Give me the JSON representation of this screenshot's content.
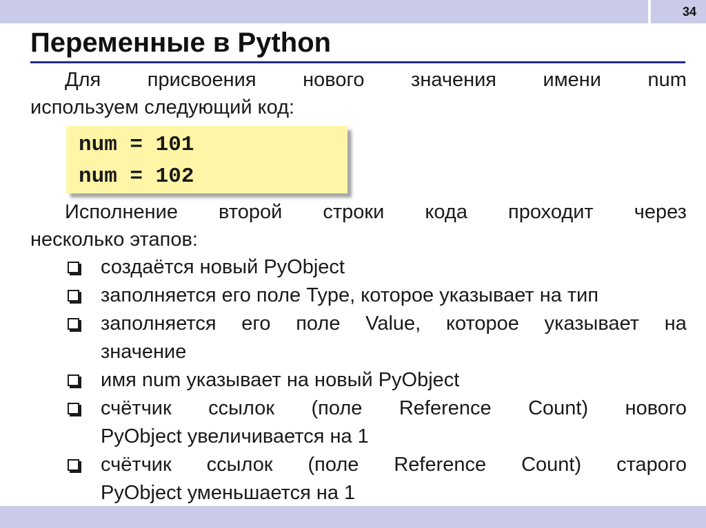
{
  "slide": {
    "page_number": "34",
    "title": "Переменные в Python"
  },
  "intro": {
    "line1_words": [
      "Для",
      "присвоения",
      "нового",
      "значения",
      "имени",
      "num"
    ],
    "line2": "используем следующий код:"
  },
  "code": {
    "lines": [
      "num = 101",
      "num = 102"
    ]
  },
  "execution": {
    "line1_words": [
      "Исполнение",
      "второй",
      "строки",
      "кода",
      "проходит",
      "через"
    ],
    "line2": "несколько этапов:"
  },
  "bullets": [
    {
      "line1_words": [
        "создаётся новый PyObject"
      ],
      "line2": ""
    },
    {
      "line1_words": [
        "заполняется его поле Type, которое указывает на тип"
      ],
      "line2": ""
    },
    {
      "line1_words": [
        "заполняется",
        "его",
        "поле",
        "Value,",
        "которое",
        "указывает",
        "на"
      ],
      "line2": "значение"
    },
    {
      "line1_words": [
        "имя num указывает на новый PyObject"
      ],
      "line2": ""
    },
    {
      "line1_words": [
        "счётчик",
        "ссылок",
        "(поле",
        "Reference",
        "Count)",
        "нового"
      ],
      "line2": "PyObject увеличивается на 1"
    },
    {
      "line1_words": [
        "счётчик",
        "ссылок",
        "(поле",
        "Reference",
        "Count)",
        "старого"
      ],
      "line2": "PyObject уменьшается на 1"
    }
  ]
}
